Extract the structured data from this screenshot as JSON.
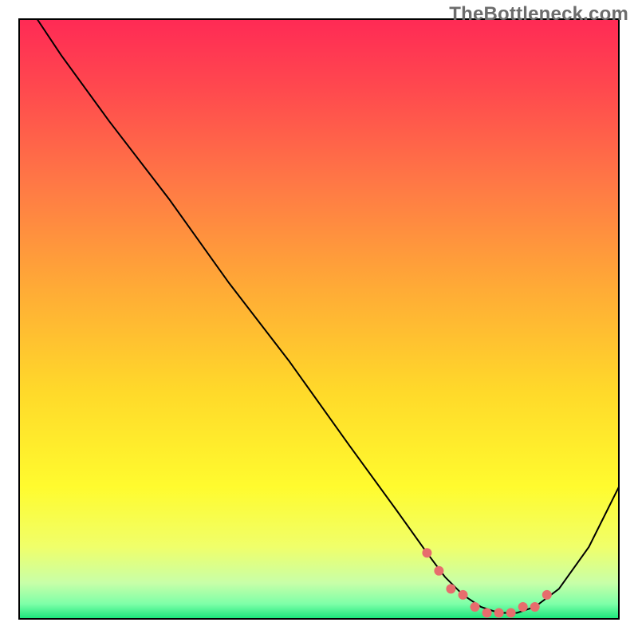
{
  "watermark": "TheBottleneck.com",
  "chart_data": {
    "type": "line",
    "title": "",
    "xlabel": "",
    "ylabel": "",
    "xlim": [
      0,
      100
    ],
    "ylim": [
      0,
      100
    ],
    "grid": false,
    "legend": false,
    "background_gradient_stops": [
      {
        "offset": 0.0,
        "color": "#ff2a55"
      },
      {
        "offset": 0.12,
        "color": "#ff4a4e"
      },
      {
        "offset": 0.28,
        "color": "#ff7a45"
      },
      {
        "offset": 0.45,
        "color": "#ffab36"
      },
      {
        "offset": 0.62,
        "color": "#ffd92a"
      },
      {
        "offset": 0.78,
        "color": "#fffb2e"
      },
      {
        "offset": 0.88,
        "color": "#f0ff6a"
      },
      {
        "offset": 0.94,
        "color": "#c8ffa8"
      },
      {
        "offset": 0.975,
        "color": "#7effa8"
      },
      {
        "offset": 1.0,
        "color": "#18e67a"
      }
    ],
    "series": [
      {
        "name": "curve",
        "color": "#000000",
        "x": [
          3,
          7,
          15,
          25,
          35,
          45,
          55,
          63,
          68,
          71,
          74,
          77,
          80,
          83,
          86,
          90,
          95,
          100
        ],
        "values": [
          100,
          94,
          83,
          70,
          56,
          43,
          29,
          18,
          11,
          7,
          4,
          2,
          1,
          1,
          2,
          5,
          12,
          22
        ]
      }
    ],
    "highlight_points": {
      "name": "valley-dots",
      "color": "#e76d6d",
      "radius": 6,
      "x": [
        68,
        70,
        72,
        74,
        76,
        78,
        80,
        82,
        84,
        86,
        88
      ],
      "values": [
        11,
        8,
        5,
        4,
        2,
        1,
        1,
        1,
        2,
        2,
        4
      ]
    }
  }
}
